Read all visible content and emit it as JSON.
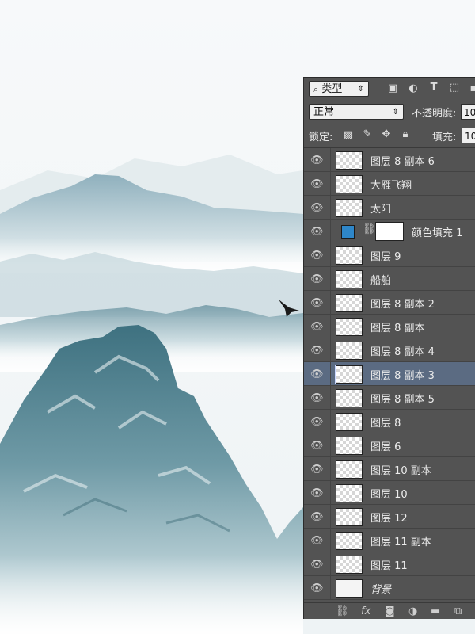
{
  "panel": {
    "filter": {
      "kind_label": "类型",
      "icons": [
        "image-filter-icon",
        "adjustment-filter-icon",
        "text-filter-icon",
        "shape-filter-icon"
      ]
    },
    "blend": {
      "mode": "正常",
      "opacity_label": "不透明度:",
      "opacity_value": "10"
    },
    "lock": {
      "label": "锁定:",
      "fill_label": "填充:",
      "fill_value": "10"
    },
    "layers": [
      {
        "name": "图层 8 副本 6",
        "thumb": "checker"
      },
      {
        "name": "大雁飞翔",
        "thumb": "checker"
      },
      {
        "name": "太阳",
        "thumb": "checker"
      },
      {
        "name": "颜色填充 1",
        "thumb": "fill"
      },
      {
        "name": "图层 9",
        "thumb": "checker"
      },
      {
        "name": "船舶",
        "thumb": "checker"
      },
      {
        "name": "图层 8 副本 2",
        "thumb": "checker"
      },
      {
        "name": "图层 8 副本",
        "thumb": "checker"
      },
      {
        "name": "图层 8 副本 4",
        "thumb": "checker"
      },
      {
        "name": "图层 8 副本 3",
        "thumb": "checker",
        "selected": true
      },
      {
        "name": "图层 8 副本 5",
        "thumb": "checker"
      },
      {
        "name": "图层 8",
        "thumb": "checker"
      },
      {
        "name": "图层 6",
        "thumb": "checker"
      },
      {
        "name": "图层 10 副本",
        "thumb": "checker"
      },
      {
        "name": "图层 10",
        "thumb": "checker"
      },
      {
        "name": "图层 12",
        "thumb": "checker"
      },
      {
        "name": "图层 11 副本",
        "thumb": "checker"
      },
      {
        "name": "图层 11",
        "thumb": "checker"
      },
      {
        "name": "背景",
        "thumb": "plain",
        "italic": true
      }
    ],
    "bottom_icons": [
      "link-icon",
      "fx-icon",
      "mask-icon",
      "adjustment-icon",
      "folder-icon",
      "new-layer-icon"
    ],
    "fx_label": "fx"
  },
  "colors": {
    "panel_bg": "#535353",
    "selected_row": "#5b6b82",
    "fill_swatch": "#2e86c8"
  }
}
